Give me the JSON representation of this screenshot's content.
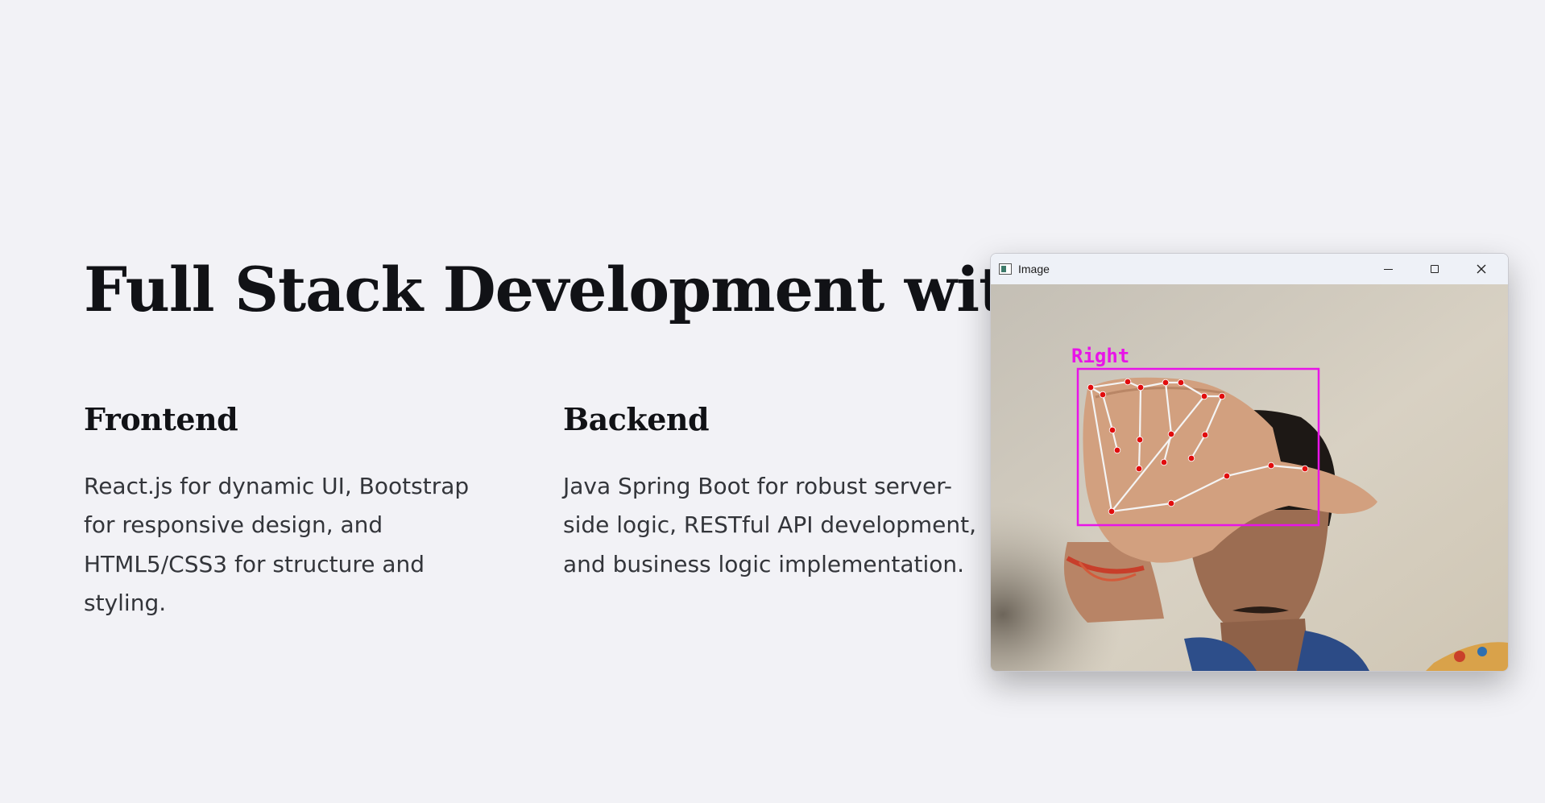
{
  "page": {
    "title": "Full Stack Development with Java",
    "columns": [
      {
        "heading": "Frontend",
        "text": "React.js for dynamic UI, Bootstrap for responsive design, and HTML5/CSS3 for structure and styling."
      },
      {
        "heading": "Backend",
        "text": "Java Spring Boot for robust server-side logic, RESTful API development, and business logic implementation."
      }
    ]
  },
  "overlay_window": {
    "title": "Image",
    "icon": "image-app-icon",
    "controls": {
      "minimize_icon": "minimize-icon",
      "maximize_icon": "maximize-icon",
      "close_icon": "close-icon"
    },
    "detection_label": "Right",
    "colors": {
      "bounding_box": "#e814e8",
      "landmark_point": "#e10d0d",
      "skeleton_line": "#f4f4f4"
    }
  },
  "colors": {
    "background": "#f2f2f6",
    "heading_text": "#111216",
    "body_text": "#33353a"
  }
}
